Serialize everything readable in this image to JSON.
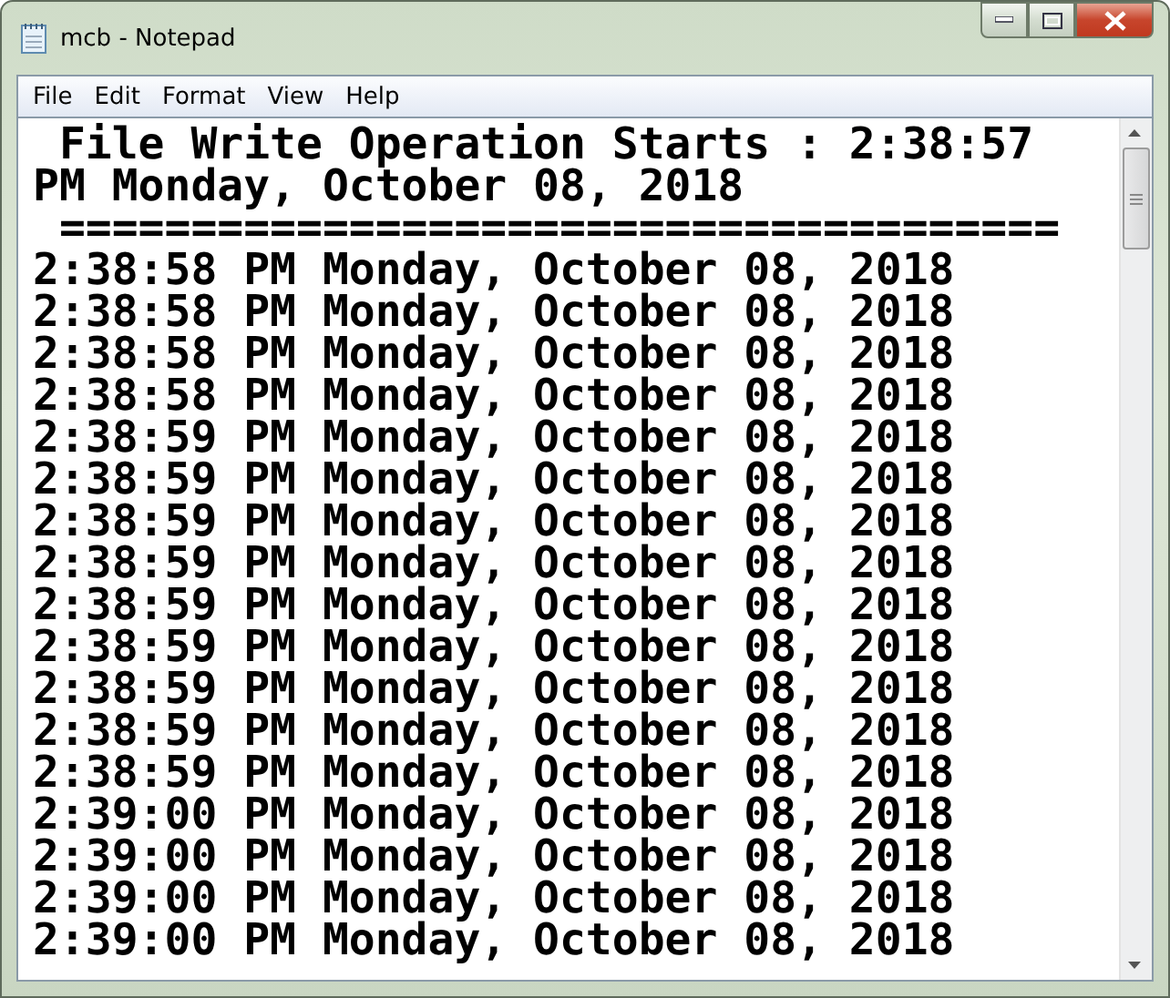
{
  "window": {
    "title": "mcb - Notepad"
  },
  "menu": [
    "File",
    "Edit",
    "Format",
    "View",
    "Help"
  ],
  "lines": [
    " File Write Operation Starts : 2:38:57 PM Monday, October 08, 2018",
    " ======================================",
    "2:38:58 PM Monday, October 08, 2018",
    "2:38:58 PM Monday, October 08, 2018",
    "2:38:58 PM Monday, October 08, 2018",
    "2:38:58 PM Monday, October 08, 2018",
    "2:38:59 PM Monday, October 08, 2018",
    "2:38:59 PM Monday, October 08, 2018",
    "2:38:59 PM Monday, October 08, 2018",
    "2:38:59 PM Monday, October 08, 2018",
    "2:38:59 PM Monday, October 08, 2018",
    "2:38:59 PM Monday, October 08, 2018",
    "2:38:59 PM Monday, October 08, 2018",
    "2:38:59 PM Monday, October 08, 2018",
    "2:38:59 PM Monday, October 08, 2018",
    "2:39:00 PM Monday, October 08, 2018",
    "2:39:00 PM Monday, October 08, 2018",
    "2:39:00 PM Monday, October 08, 2018",
    "2:39:00 PM Monday, October 08, 2018"
  ]
}
